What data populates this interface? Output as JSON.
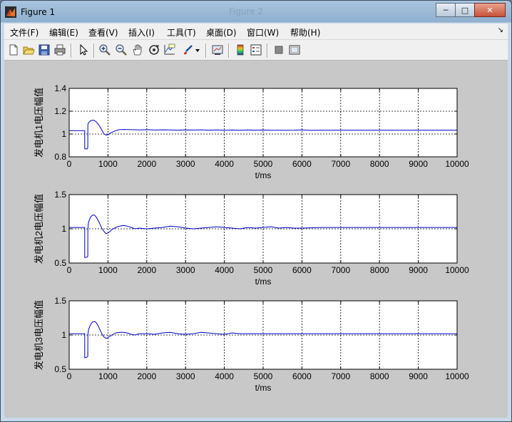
{
  "window": {
    "title": "Figure 1",
    "background_title_ghost": "Figure 2",
    "buttons": [
      "minimize",
      "maximize",
      "close"
    ]
  },
  "menu": {
    "items": [
      "文件(F)",
      "编辑(E)",
      "查看(V)",
      "插入(I)",
      "工具(T)",
      "桌面(D)",
      "窗口(W)",
      "帮助(H)"
    ]
  },
  "toolbar": {
    "icons": [
      "new-figure-icon",
      "open-file-icon",
      "save-icon",
      "print-icon",
      "select-arrow-icon",
      "zoom-in-icon",
      "zoom-out-icon",
      "pan-hand-icon",
      "rotate-3d-icon",
      "data-cursor-icon",
      "brush-icon",
      "brush-dropdown-icon",
      "link-plot-icon",
      "insert-colorbar-icon",
      "insert-legend-icon",
      "hide-plot-tools-icon",
      "show-plot-tools-icon"
    ]
  },
  "chart_data": [
    {
      "type": "line",
      "ylabel": "发电机1电压幅值",
      "xlabel": "t/ms",
      "xlim": [
        0,
        10000
      ],
      "ylim": [
        0.8,
        1.4
      ],
      "xticks": [
        0,
        1000,
        2000,
        3000,
        4000,
        5000,
        6000,
        7000,
        8000,
        9000,
        10000
      ],
      "yticks": [
        0.8,
        1,
        1.2,
        1.4
      ],
      "ytick_labels": [
        "0.8",
        "1",
        "1.2",
        "1.4"
      ],
      "grid": true,
      "color": "#0000cc",
      "series": [
        {
          "x": [
            0,
            400,
            401,
            420,
            470,
            480,
            481,
            500,
            550,
            600,
            650,
            700,
            750,
            800,
            850,
            900,
            950,
            1000,
            1100,
            1200,
            1300,
            1400,
            1600,
            1800,
            2000,
            2200,
            2400,
            2600,
            2800,
            3000,
            3200,
            3400,
            3600,
            3800,
            4000,
            4200,
            4400,
            4600,
            4800,
            5000,
            5200,
            5400,
            5600,
            5800,
            6000,
            6200,
            6500,
            7000,
            8000,
            9000,
            10000
          ],
          "y": [
            1.03,
            1.03,
            0.87,
            0.87,
            0.87,
            0.88,
            1.08,
            1.1,
            1.115,
            1.122,
            1.118,
            1.105,
            1.085,
            1.06,
            1.03,
            1.0,
            0.99,
            0.995,
            1.015,
            1.03,
            1.038,
            1.04,
            1.038,
            1.036,
            1.038,
            1.035,
            1.037,
            1.036,
            1.034,
            1.036,
            1.035,
            1.037,
            1.034,
            1.036,
            1.033,
            1.035,
            1.033,
            1.036,
            1.034,
            1.035,
            1.033,
            1.034,
            1.033,
            1.034,
            1.036,
            1.033,
            1.034,
            1.034,
            1.034,
            1.034,
            1.034
          ]
        }
      ]
    },
    {
      "type": "line",
      "ylabel": "发电机2电压幅值",
      "xlabel": "t/ms",
      "xlim": [
        0,
        10000
      ],
      "ylim": [
        0.5,
        1.5
      ],
      "xticks": [
        0,
        1000,
        2000,
        3000,
        4000,
        5000,
        6000,
        7000,
        8000,
        9000,
        10000
      ],
      "yticks": [
        0.5,
        1,
        1.5
      ],
      "ytick_labels": [
        "0.5",
        "1",
        "1.5"
      ],
      "grid": true,
      "color": "#0000cc",
      "series": [
        {
          "x": [
            0,
            400,
            401,
            420,
            470,
            480,
            481,
            500,
            550,
            600,
            650,
            700,
            750,
            800,
            850,
            900,
            950,
            1000,
            1050,
            1100,
            1200,
            1300,
            1400,
            1500,
            1600,
            1700,
            1800,
            2000,
            2200,
            2400,
            2600,
            2800,
            3000,
            3200,
            3400,
            3600,
            3800,
            4000,
            4200,
            4400,
            4600,
            4800,
            5000,
            5200,
            5400,
            5600,
            5800,
            6000,
            6500,
            7000,
            8000,
            9000,
            10000
          ],
          "y": [
            1.02,
            1.02,
            0.58,
            0.58,
            0.59,
            0.6,
            1.0,
            1.1,
            1.17,
            1.2,
            1.2,
            1.17,
            1.12,
            1.06,
            1.0,
            0.96,
            0.93,
            0.94,
            0.96,
            0.99,
            1.02,
            1.04,
            1.05,
            1.04,
            1.02,
            1.0,
            1.01,
            1.0,
            1.01,
            1.02,
            1.04,
            1.03,
            1.01,
            1.0,
            1.01,
            1.02,
            1.03,
            1.02,
            1.01,
            1.0,
            1.02,
            1.01,
            1.02,
            1.03,
            1.01,
            1.02,
            1.01,
            1.01,
            1.02,
            1.02,
            1.02,
            1.02,
            1.02
          ]
        }
      ]
    },
    {
      "type": "line",
      "ylabel": "发电机3电压幅值",
      "xlabel": "t/ms",
      "xlim": [
        0,
        10000
      ],
      "ylim": [
        0.5,
        1.5
      ],
      "xticks": [
        0,
        1000,
        2000,
        3000,
        4000,
        5000,
        6000,
        7000,
        8000,
        9000,
        10000
      ],
      "yticks": [
        0.5,
        1,
        1.5
      ],
      "ytick_labels": [
        "0.5",
        "1",
        "1.5"
      ],
      "grid": true,
      "color": "#0000cc",
      "series": [
        {
          "x": [
            0,
            400,
            401,
            420,
            470,
            480,
            481,
            500,
            550,
            600,
            650,
            700,
            750,
            800,
            850,
            900,
            950,
            1000,
            1050,
            1100,
            1200,
            1300,
            1400,
            1500,
            1600,
            1700,
            1800,
            2000,
            2200,
            2400,
            2600,
            2800,
            3000,
            3200,
            3400,
            3600,
            3800,
            4000,
            4200,
            4400,
            4600,
            5000,
            6000,
            7000,
            8000,
            9000,
            10000
          ],
          "y": [
            1.02,
            1.02,
            0.67,
            0.67,
            0.68,
            0.69,
            1.0,
            1.08,
            1.15,
            1.19,
            1.2,
            1.18,
            1.13,
            1.07,
            1.01,
            0.97,
            0.95,
            0.96,
            0.98,
            1.0,
            1.03,
            1.04,
            1.04,
            1.03,
            1.01,
            1.0,
            1.02,
            1.02,
            1.01,
            1.03,
            1.04,
            1.02,
            1.01,
            1.02,
            1.04,
            1.03,
            1.02,
            1.01,
            1.03,
            1.02,
            1.02,
            1.02,
            1.02,
            1.02,
            1.02,
            1.02,
            1.02
          ]
        }
      ]
    }
  ]
}
